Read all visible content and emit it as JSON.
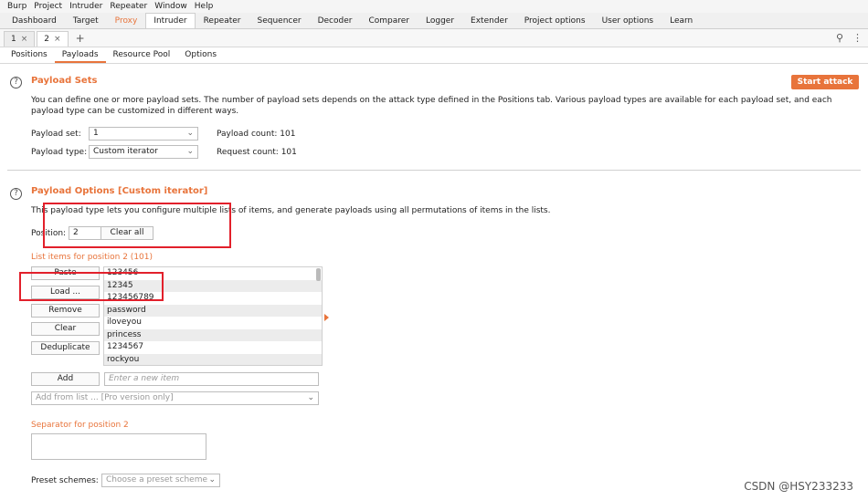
{
  "menubar": [
    "Burp",
    "Project",
    "Intruder",
    "Repeater",
    "Window",
    "Help"
  ],
  "top_tabs": [
    {
      "label": "Dashboard",
      "style": ""
    },
    {
      "label": "Target",
      "style": ""
    },
    {
      "label": "Proxy",
      "style": "orange"
    },
    {
      "label": "Intruder",
      "style": "active"
    },
    {
      "label": "Repeater",
      "style": ""
    },
    {
      "label": "Sequencer",
      "style": ""
    },
    {
      "label": "Decoder",
      "style": ""
    },
    {
      "label": "Comparer",
      "style": ""
    },
    {
      "label": "Logger",
      "style": ""
    },
    {
      "label": "Extender",
      "style": ""
    },
    {
      "label": "Project options",
      "style": ""
    },
    {
      "label": "User options",
      "style": ""
    },
    {
      "label": "Learn",
      "style": ""
    }
  ],
  "attack_tabs": [
    {
      "label": "1",
      "close": "×",
      "active": false
    },
    {
      "label": "2",
      "close": "×",
      "active": true
    }
  ],
  "attack_tabs_add": "+",
  "icons": {
    "search": "search-icon",
    "more": "kebab-menu-icon",
    "help": "help-icon",
    "chevron": "chevron-down-icon"
  },
  "inner_tabs": [
    {
      "label": "Positions",
      "active": false
    },
    {
      "label": "Payloads",
      "active": true
    },
    {
      "label": "Resource Pool",
      "active": false
    },
    {
      "label": "Options",
      "active": false
    }
  ],
  "payload_sets": {
    "title": "Payload Sets",
    "description": "You can define one or more payload sets. The number of payload sets depends on the attack type defined in the Positions tab. Various payload types are available for each payload set, and each payload type can be customized in different ways.",
    "start_attack": "Start attack",
    "payload_set_label": "Payload set:",
    "payload_set_value": "1",
    "payload_type_label": "Payload type:",
    "payload_type_value": "Custom iterator",
    "payload_count": "Payload count:  101",
    "request_count": "Request count:  101"
  },
  "payload_options": {
    "title": "Payload Options [Custom iterator]",
    "description": "This payload type lets you configure multiple lists of items, and generate payloads using all permutations of items in the lists.",
    "position_label": "Position:",
    "position_value": "2",
    "clear_all": "Clear all",
    "list_label": "List items for position 2 (101)",
    "buttons": {
      "paste": "Paste",
      "load": "Load ...",
      "remove": "Remove",
      "clear": "Clear",
      "deduplicate": "Deduplicate",
      "add": "Add"
    },
    "items": [
      "123456",
      "12345",
      "123456789",
      "password",
      "iloveyou",
      "princess",
      "1234567",
      "rockyou"
    ],
    "new_item_placeholder": "Enter a new item",
    "add_from_list": "Add from list ... [Pro version only]",
    "separator_label": "Separator for position 2",
    "preset_label": "Preset schemes:",
    "preset_placeholder": "Choose a preset scheme"
  },
  "colors": {
    "accent": "#e8743b",
    "highlight": "#e2202b"
  },
  "watermark": "CSDN @HSY233233"
}
